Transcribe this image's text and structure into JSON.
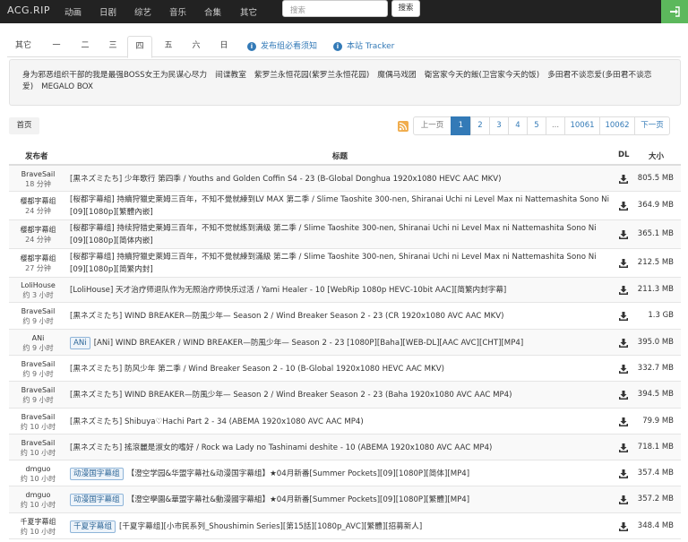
{
  "nav": {
    "brand": "ACG.RIP",
    "links": [
      "动画",
      "日剧",
      "综艺",
      "音乐",
      "合集",
      "其它"
    ],
    "search_placeholder": "搜索",
    "search_button": "搜索"
  },
  "tabs": {
    "days": [
      "其它",
      "一",
      "二",
      "三",
      "四",
      "五",
      "六",
      "日"
    ],
    "active": "四",
    "info_links": [
      "发布组必看须知",
      "本站 Tracker"
    ]
  },
  "airing": [
    "身为邪恶组织干部的我是最强BOSS女王为民谋心尽力",
    "间谍教室",
    "紫罗兰永恒花园(紫罗兰永恒花园)",
    "魔偶马戏团",
    "衛宮家今天的飯(卫宫家今天的饭)",
    "多田君不谈恋爱(多田君不谈恋爱)",
    "MEGALO BOX"
  ],
  "pager": {
    "home": "首页",
    "prev": "上一页",
    "pages": [
      "1",
      "2",
      "3",
      "4",
      "5",
      "...",
      "10061",
      "10062"
    ],
    "active_page": "1",
    "next": "下一页"
  },
  "table": {
    "headers": {
      "publisher": "发布者",
      "title": "标题",
      "dl": "DL",
      "size": "大小"
    },
    "rows": [
      {
        "publisher": "BraveSail",
        "time": "18 分钟",
        "tag": "",
        "title": "[黒ネズミたち] 少年歌行 第四季 / Youths and Golden Coffin S4 - 23 (B-Global Donghua 1920x1080 HEVC AAC MKV)",
        "size": "805.5 MB"
      },
      {
        "publisher": "樱都字幕组",
        "time": "24 分钟",
        "tag": "",
        "title": "[桜都字幕組] 持續狩獵史萊姆三百年，不知不覺就練到LV MAX 第二季 / Slime Taoshite 300-nen, Shiranai Uchi ni Level Max ni Nattemashita Sono Ni [09][1080p][繁體內嵌]",
        "size": "364.9 MB"
      },
      {
        "publisher": "樱都字幕组",
        "time": "24 分钟",
        "tag": "",
        "title": "[桜都字幕组] 持续狩猎史莱姆三百年，不知不觉就练到满级 第二季 / Slime Taoshite 300-nen, Shiranai Uchi ni Level Max ni Nattemashita Sono Ni [09][1080p][简体内嵌]",
        "size": "365.1 MB"
      },
      {
        "publisher": "樱都字幕组",
        "time": "27 分钟",
        "tag": "",
        "title": "[桜都字幕组] 持續狩獵史萊姆三百年，不知不覺就練到滿級 第二季 / Slime Taoshite 300-nen, Shiranai Uchi ni Level Max ni Nattemashita Sono Ni [09][1080p][简繁内封]",
        "size": "212.5 MB"
      },
      {
        "publisher": "LoliHouse",
        "time": "约 3 小时",
        "tag": "",
        "title": "[LoliHouse] 天才治疗师退队作为无照治疗师快乐过活 / Yami Healer - 10 [WebRip 1080p HEVC-10bit AAC][简繁内封字幕]",
        "size": "211.3 MB"
      },
      {
        "publisher": "BraveSail",
        "time": "约 9 小时",
        "tag": "",
        "title": "[黒ネズミたち] WIND BREAKER—防風少年— Season 2 / Wind Breaker Season 2 - 23 (CR 1920x1080 AVC AAC MKV)",
        "size": "1.3 GB"
      },
      {
        "publisher": "ANi",
        "time": "约 9 小时",
        "tag": "ANi",
        "title": "[ANi] WIND BREAKER / WIND BREAKER—防風少年— Season 2 - 23 [1080P][Baha][WEB-DL][AAC AVC][CHT][MP4]",
        "size": "395.0 MB"
      },
      {
        "publisher": "BraveSail",
        "time": "约 9 小时",
        "tag": "",
        "title": "[黒ネズミたち] 防风少年 第二季 / Wind Breaker Season 2 - 10 (B-Global 1920x1080 HEVC AAC MKV)",
        "size": "332.7 MB"
      },
      {
        "publisher": "BraveSail",
        "time": "约 9 小时",
        "tag": "",
        "title": "[黒ネズミたち] WIND BREAKER—防風少年— Season 2 / Wind Breaker Season 2 - 23 (Baha 1920x1080 AVC AAC MP4)",
        "size": "394.5 MB"
      },
      {
        "publisher": "BraveSail",
        "time": "约 10 小时",
        "tag": "",
        "title": "[黒ネズミたち] Shibuya♡Hachi Part 2 - 34 (ABEMA 1920x1080 AVC AAC MP4)",
        "size": "79.9 MB"
      },
      {
        "publisher": "BraveSail",
        "time": "约 10 小时",
        "tag": "",
        "title": "[黒ネズミたち] 搖滾麗是淑女的嗜好 / Rock wa Lady no Tashinami deshite - 10 (ABEMA 1920x1080 AVC AAC MP4)",
        "size": "718.1 MB"
      },
      {
        "publisher": "dmguo",
        "time": "约 10 小时",
        "tag": "动漫国字幕组",
        "title": "【澄空学园&华盟字幕社&动漫国字幕组】★04月新番[Summer Pockets][09][1080P][简体][MP4]",
        "size": "357.4 MB"
      },
      {
        "publisher": "dmguo",
        "time": "约 10 小时",
        "tag": "动漫国字幕组",
        "title": "【澄空學園&華盟字幕社&動漫國字幕組】★04月新番[Summer Pockets][09][1080P][繁體][MP4]",
        "size": "357.2 MB"
      },
      {
        "publisher": "千夏字幕组",
        "time": "约 10 小时",
        "tag": "千夏字幕组",
        "title": "[千夏字幕组][小市民系列_Shoushimin Series][第15話][1080p_AVC][繁體][招募新人]",
        "size": "348.4 MB"
      }
    ]
  }
}
